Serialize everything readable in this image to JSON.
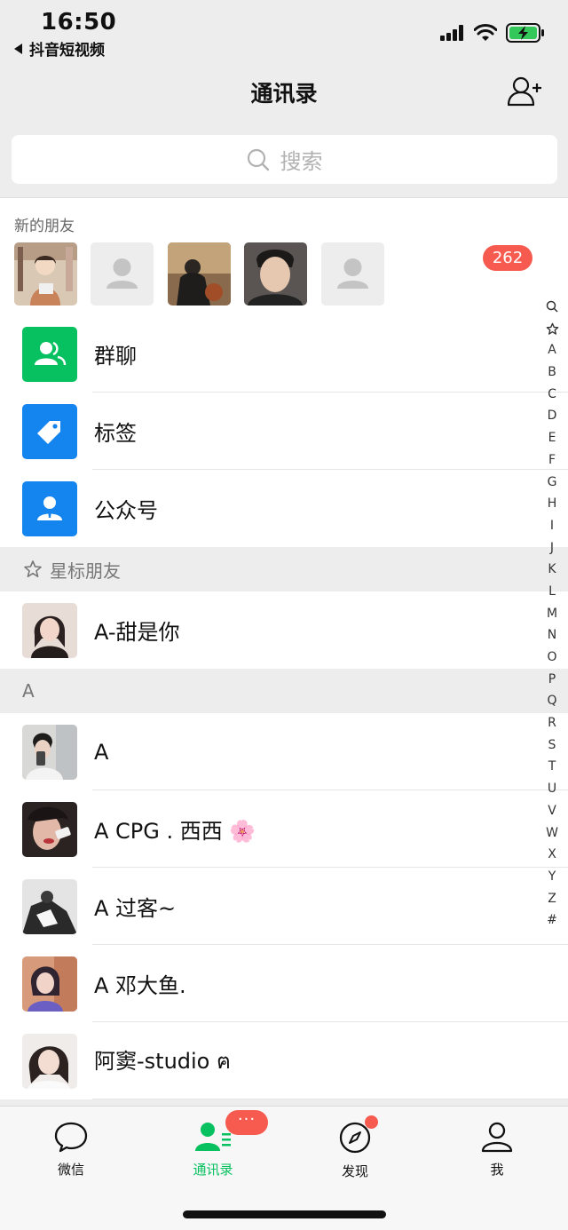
{
  "status_bar": {
    "time": "16:50",
    "back_app": "抖音短视频",
    "icons": [
      "cellular-signal-icon",
      "wifi-icon",
      "battery-charging-icon"
    ]
  },
  "nav": {
    "title": "通讯录",
    "add_contact_icon": "add-contact-icon"
  },
  "search": {
    "placeholder": "搜索",
    "icon": "search-icon"
  },
  "new_friends": {
    "label": "新的朋友",
    "badge": "262",
    "avatars": [
      "avatar-1",
      "avatar-placeholder",
      "avatar-2",
      "avatar-3",
      "avatar-placeholder"
    ]
  },
  "features": [
    {
      "label": "群聊",
      "icon": "group-chat-icon",
      "color": "#07c160"
    },
    {
      "label": "标签",
      "icon": "tag-icon",
      "color": "#1485ee"
    },
    {
      "label": "公众号",
      "icon": "official-account-icon",
      "color": "#1485ee"
    }
  ],
  "starred": {
    "header": "星标朋友",
    "contacts": [
      {
        "name": "A-甜是你"
      }
    ]
  },
  "section_a": {
    "header": "A",
    "contacts": [
      {
        "name": "A"
      },
      {
        "name": "A  CPG . 西西 🌸"
      },
      {
        "name": "A  过客~"
      },
      {
        "name": "A 邓大鱼."
      },
      {
        "name": "阿窦-studio ฅ"
      }
    ]
  },
  "index_letters": [
    "🔍",
    "☆",
    "A",
    "B",
    "C",
    "D",
    "E",
    "F",
    "G",
    "H",
    "I",
    "J",
    "K",
    "L",
    "M",
    "N",
    "O",
    "P",
    "Q",
    "R",
    "S",
    "T",
    "U",
    "V",
    "W",
    "X",
    "Y",
    "Z",
    "#"
  ],
  "tabbar": {
    "tabs": [
      {
        "label": "微信",
        "icon": "chat-bubble-icon"
      },
      {
        "label": "通讯录",
        "icon": "contacts-icon",
        "active": true
      },
      {
        "label": "发现",
        "icon": "compass-icon"
      },
      {
        "label": "我",
        "icon": "me-icon"
      }
    ],
    "contacts_badge": "···"
  },
  "colors": {
    "accent": "#07c160",
    "badge": "#f75b4f",
    "blue": "#1485ee",
    "background": "#ededed"
  }
}
